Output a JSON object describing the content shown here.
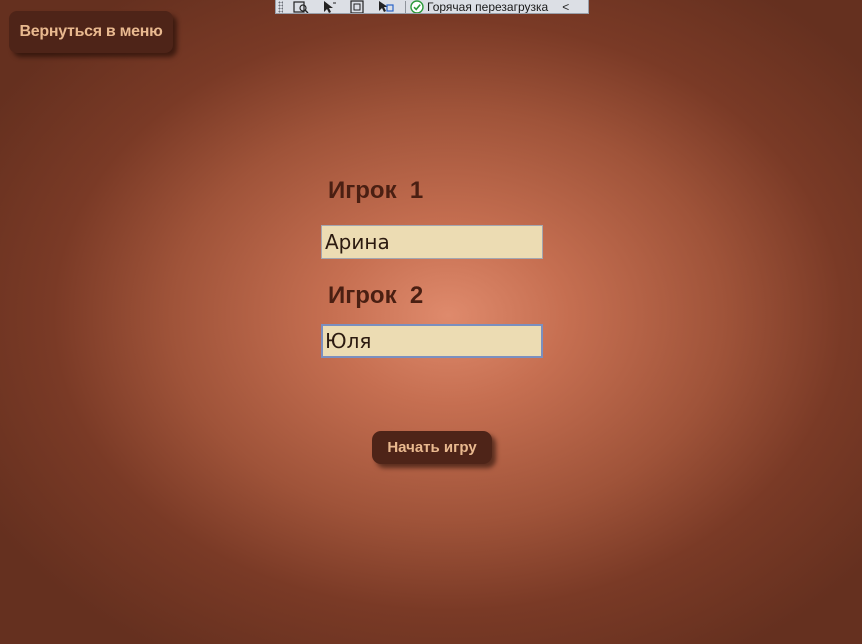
{
  "toolbar": {
    "icons": [
      "select-element-icon",
      "pointer-select-icon",
      "layout-bounds-icon",
      "track-focus-icon"
    ],
    "hot_reload_label": "Горячая перезагрузка",
    "collapse_glyph": "<"
  },
  "menu": {
    "back_button_label": "Вернуться в меню"
  },
  "players": [
    {
      "label": "Игрок  1",
      "name_value": "Арина"
    },
    {
      "label": "Игрок  2",
      "name_value": "Юля"
    }
  ],
  "start_button_label": "Начать игру",
  "colors": {
    "button_bg": "#4e2418",
    "button_text": "#e9b98f",
    "label_text": "#4a1f12",
    "input_bg": "#ecdcb3",
    "background_center": "#df8a6c",
    "background_edge": "#65301f"
  }
}
